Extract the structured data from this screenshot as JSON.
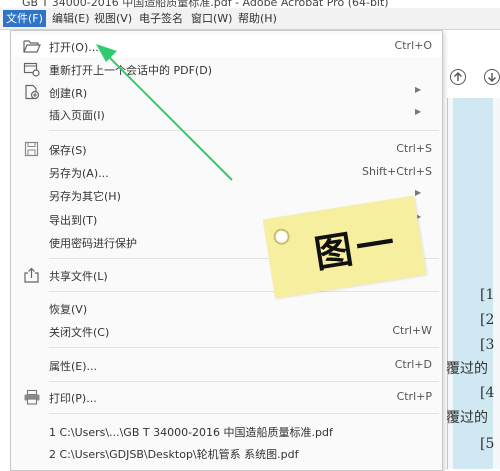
{
  "window_title": "GB T 34000-2016 中国造船质量标准.pdf - Adobe Acrobat Pro (64-bit)",
  "menubar": [
    "文件(F)",
    "编辑(E)",
    "视图(V)",
    "电子签名",
    "窗口(W)",
    "帮助(H)"
  ],
  "menu": {
    "open": {
      "label": "打开(O)...",
      "shortcut": "Ctrl+O"
    },
    "reopen": {
      "label": "重新打开上一个会话中的 PDF(D)"
    },
    "create": {
      "label": "创建(R)"
    },
    "insert_pages": {
      "label": "插入页面(I)"
    },
    "save": {
      "label": "保存(S)",
      "shortcut": "Ctrl+S"
    },
    "save_as": {
      "label": "另存为(A)...",
      "shortcut": "Shift+Ctrl+S"
    },
    "save_as_other": {
      "label": "另存为其它(H)"
    },
    "export_to": {
      "label": "导出到(T)"
    },
    "protect_password": {
      "label": "使用密码进行保护"
    },
    "share_file": {
      "label": "共享文件(L)"
    },
    "revert": {
      "label": "恢复(V)"
    },
    "close_file": {
      "label": "关闭文件(C)",
      "shortcut": "Ctrl+W"
    },
    "properties": {
      "label": "属性(E)...",
      "shortcut": "Ctrl+D"
    },
    "print": {
      "label": "打印(P)...",
      "shortcut": "Ctrl+P"
    },
    "recent_1": {
      "label": "1 C:\\Users\\...\\GB T 34000-2016 中国造船质量标准.pdf"
    },
    "recent_2": {
      "label": "2 C:\\Users\\GDJSB\\Desktop\\轮机管系 系统图.pdf"
    }
  },
  "annotation": {
    "text": "图一"
  },
  "doc_refs": [
    "[1",
    "[2",
    "[3",
    "覆过的",
    "[4",
    "覆过的",
    "[5"
  ],
  "colors": {
    "menubar_active": "#2f74c6",
    "arrow": "#2ecc71",
    "sticker": "#f6efa0"
  }
}
